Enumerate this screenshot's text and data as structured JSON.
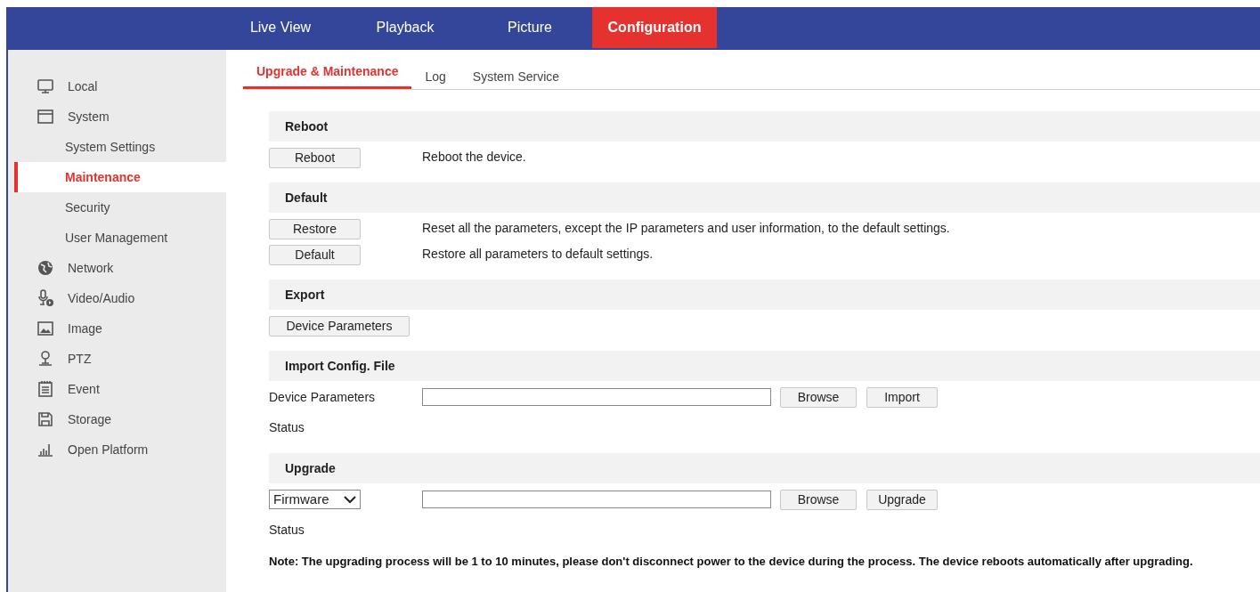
{
  "top_tabs": [
    {
      "label": "Live View",
      "selected": false
    },
    {
      "label": "Playback",
      "selected": false
    },
    {
      "label": "Picture",
      "selected": false
    },
    {
      "label": "Configuration",
      "selected": true
    }
  ],
  "sidebar": {
    "items": [
      {
        "label": "Local",
        "selected": false
      },
      {
        "label": "System",
        "selected": false,
        "children": [
          {
            "label": "System Settings",
            "selected": false
          },
          {
            "label": "Maintenance",
            "selected": true
          },
          {
            "label": "Security",
            "selected": false
          },
          {
            "label": "User Management",
            "selected": false
          }
        ]
      },
      {
        "label": "Network",
        "selected": false
      },
      {
        "label": "Video/Audio",
        "selected": false
      },
      {
        "label": "Image",
        "selected": false
      },
      {
        "label": "PTZ",
        "selected": false
      },
      {
        "label": "Event",
        "selected": false
      },
      {
        "label": "Storage",
        "selected": false
      },
      {
        "label": "Open Platform",
        "selected": false
      }
    ]
  },
  "sub_tabs": [
    {
      "label": "Upgrade & Maintenance",
      "selected": true
    },
    {
      "label": "Log",
      "selected": false
    },
    {
      "label": "System Service",
      "selected": false
    }
  ],
  "sections": [
    {
      "title": "Reboot",
      "rows": [
        {
          "kind": "action",
          "button": "Reboot",
          "description": "Reboot the device."
        }
      ]
    },
    {
      "title": "Default",
      "rows": [
        {
          "kind": "action",
          "button": "Restore",
          "description": "Reset all the parameters, except the IP parameters and user information, to the default settings."
        },
        {
          "kind": "action",
          "button": "Default",
          "description": "Restore all parameters to default settings."
        }
      ]
    },
    {
      "title": "Export",
      "rows": [
        {
          "kind": "action",
          "button": "Device Parameters"
        }
      ]
    },
    {
      "title": "Import Config. File",
      "rows": [
        {
          "kind": "file",
          "label": "Device Parameters",
          "buttons": [
            "Browse",
            "Import"
          ]
        },
        {
          "kind": "text",
          "label": "Status"
        }
      ]
    },
    {
      "title": "Upgrade",
      "rows": [
        {
          "kind": "file",
          "select": "Firmware",
          "buttons": [
            "Browse",
            "Upgrade"
          ]
        },
        {
          "kind": "text",
          "label": "Status"
        },
        {
          "kind": "note",
          "text": "Note: The upgrading process will be 1 to 10 minutes, please don't disconnect power to the device during the process. The device reboots automatically after upgrading."
        }
      ]
    }
  ]
}
